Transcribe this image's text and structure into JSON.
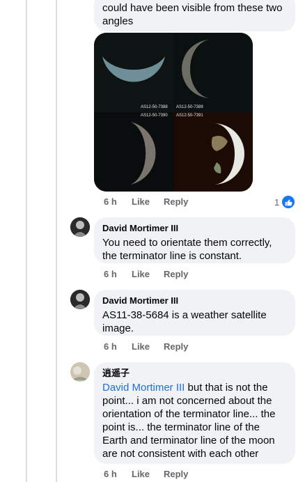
{
  "first_comment": {
    "text_tail": "could have been visible from these two angles",
    "photo_labels": [
      "AS12-50-7388",
      "AS12-50-7389",
      "AS12-50-7390",
      "AS12-50-7391"
    ],
    "meta": {
      "time": "6 h",
      "like": "Like",
      "reply": "Reply"
    },
    "reaction_count": "1"
  },
  "comments": [
    {
      "author": "David Mortimer III",
      "text": "You need to orientate them correctly, the terminator line is constant.",
      "meta": {
        "time": "6 h",
        "like": "Like",
        "reply": "Reply"
      }
    },
    {
      "author": "David Mortimer III",
      "text": "AS11-38-5684 is a weather satellite image.",
      "meta": {
        "time": "6 h",
        "like": "Like",
        "reply": "Reply"
      }
    },
    {
      "author": "逍遥子",
      "mention": "David Mortimer III",
      "text": " but that is not the point... i am not concerned about the orientation of the terminator line... the point is... the terminator line of the Earth and terminator line of the moon are not consistent with each other",
      "meta": {
        "time": "6 h",
        "like": "Like",
        "reply": "Reply"
      }
    }
  ],
  "colors": {
    "link": "#216fdb",
    "bubble": "#f0f2f5",
    "meta": "#65676b",
    "like": "#1877f2"
  }
}
